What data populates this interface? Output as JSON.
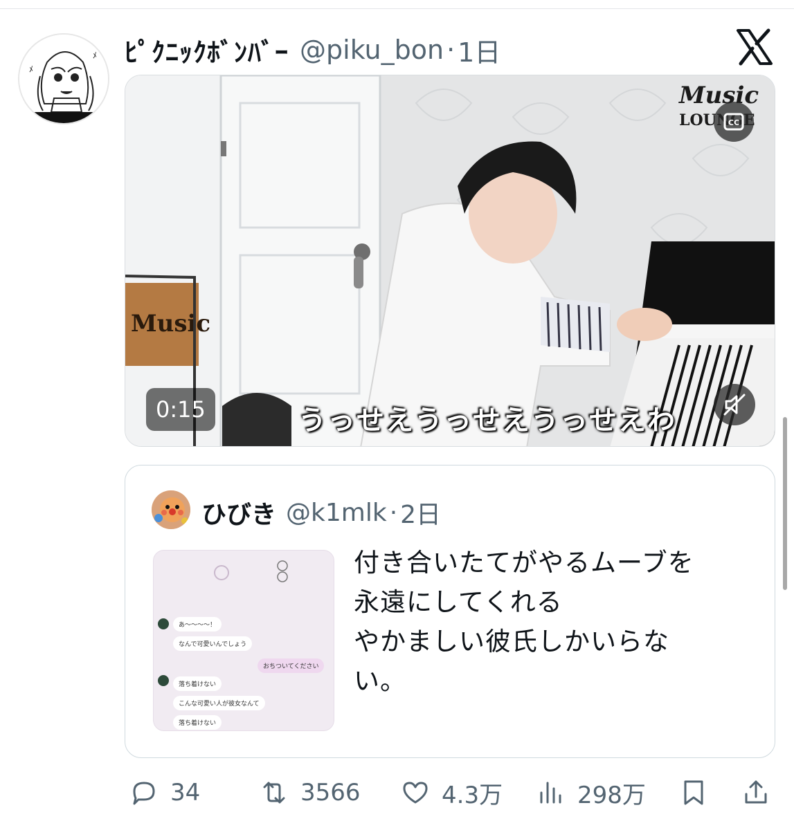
{
  "post": {
    "display_name": "ﾋﾟｸﾆｯｸﾎﾞﾝﾊﾞｰ",
    "handle": "@piku_bon",
    "separator": "·",
    "time": "1日"
  },
  "video": {
    "timestamp": "0:15",
    "subtitle": "うっせえうっせえうっせえわ",
    "watermark": "Music LOUNGE"
  },
  "quote": {
    "display_name": "ひびき",
    "handle": "@k1mlk",
    "separator": "·",
    "time": "2日",
    "text_lines": [
      "付き合いたてがやるムーブを",
      "永遠にしてくれる",
      "やかましい彼氏しかいらな",
      "い。"
    ],
    "thumbnail": {
      "messages": [
        {
          "text": "あ〜〜〜〜！",
          "side": "left"
        },
        {
          "text": "なんで可愛いんでしょう",
          "side": "left"
        },
        {
          "text": "おちついてください",
          "side": "right"
        },
        {
          "text": "落ち着けない",
          "side": "left"
        },
        {
          "text": "こんな可愛い人が彼女なんて",
          "side": "left"
        },
        {
          "text": "落ち着けない",
          "side": "left"
        }
      ]
    }
  },
  "actions": {
    "replies": "34",
    "reposts": "3566",
    "likes": "4.3万",
    "views": "298万"
  },
  "colors": {
    "text_primary": "#0f1419",
    "text_secondary": "#536471",
    "border": "#cfd9de"
  }
}
